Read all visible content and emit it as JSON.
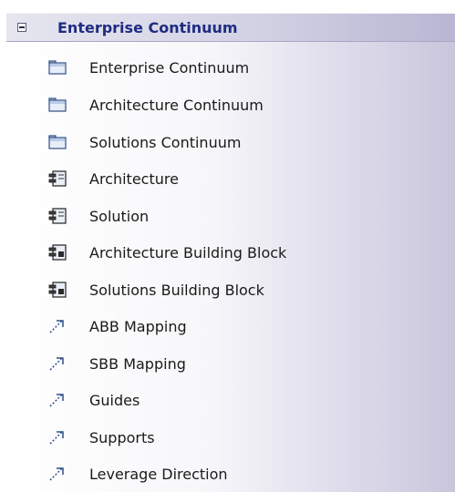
{
  "toolbox": {
    "header": {
      "title": "Enterprise Continuum",
      "collapse_icon": "minus-box-icon"
    },
    "items": [
      {
        "label": "Enterprise Continuum",
        "icon": "folder-package-icon"
      },
      {
        "label": "Architecture Continuum",
        "icon": "folder-package-icon"
      },
      {
        "label": "Solutions Continuum",
        "icon": "folder-package-icon"
      },
      {
        "label": "Architecture",
        "icon": "component-icon"
      },
      {
        "label": "Solution",
        "icon": "component-icon"
      },
      {
        "label": "Architecture Building Block",
        "icon": "building-block-icon"
      },
      {
        "label": "Solutions Building Block",
        "icon": "building-block-icon"
      },
      {
        "label": "ABB Mapping",
        "icon": "dashed-arrow-icon"
      },
      {
        "label": "SBB Mapping",
        "icon": "dashed-arrow-icon"
      },
      {
        "label": "Guides",
        "icon": "dashed-arrow-icon"
      },
      {
        "label": "Supports",
        "icon": "dashed-arrow-icon"
      },
      {
        "label": "Leverage Direction",
        "icon": "dashed-arrow-icon"
      }
    ]
  }
}
